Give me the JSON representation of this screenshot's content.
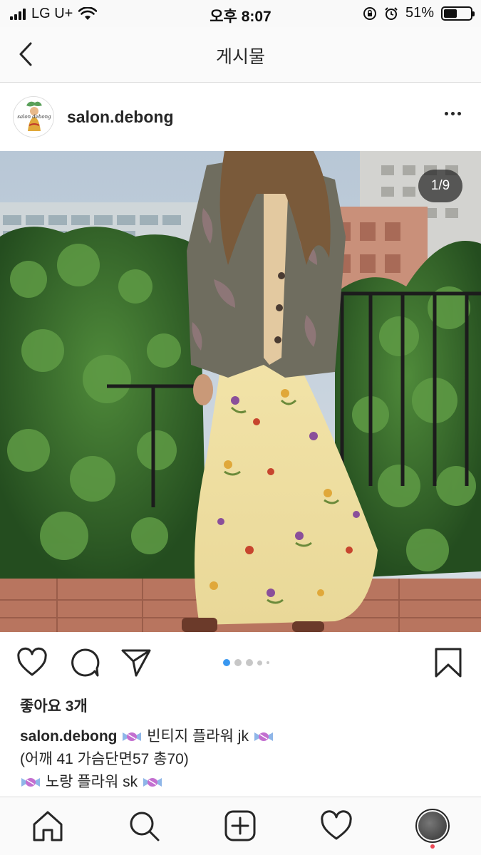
{
  "status_bar": {
    "carrier": "LG U+",
    "time": "오후 8:07",
    "battery_percent": "51%",
    "battery_level": 0.51
  },
  "header": {
    "title": "게시물"
  },
  "post": {
    "username": "salon.debong",
    "avatar_text": "salon debong",
    "image_counter": "1/9",
    "carousel_total_dots": 5,
    "carousel_active_index": 0,
    "likes": "좋아요 3개",
    "caption": {
      "username": "salon.debong",
      "line1": "빈티지 플라워 jk",
      "line2": "(어깨 41 가슴단면57 총70)",
      "line3": "노랑 플라워 sk"
    }
  },
  "icons": {
    "back": "chevron-left-icon",
    "more": "more-horizontal-icon",
    "like": "heart-outline-icon",
    "comment": "comment-bubble-icon",
    "share": "paper-plane-icon",
    "save": "bookmark-outline-icon",
    "candy": "candy-icon",
    "home": "home-icon",
    "search": "search-icon",
    "new_post": "plus-square-icon",
    "activity": "heart-icon",
    "profile": "profile-avatar-icon"
  },
  "colors": {
    "active_dot": "#3897f0",
    "inactive_dot": "#c7c7c7",
    "notification": "#ed4956",
    "text": "#262626"
  }
}
